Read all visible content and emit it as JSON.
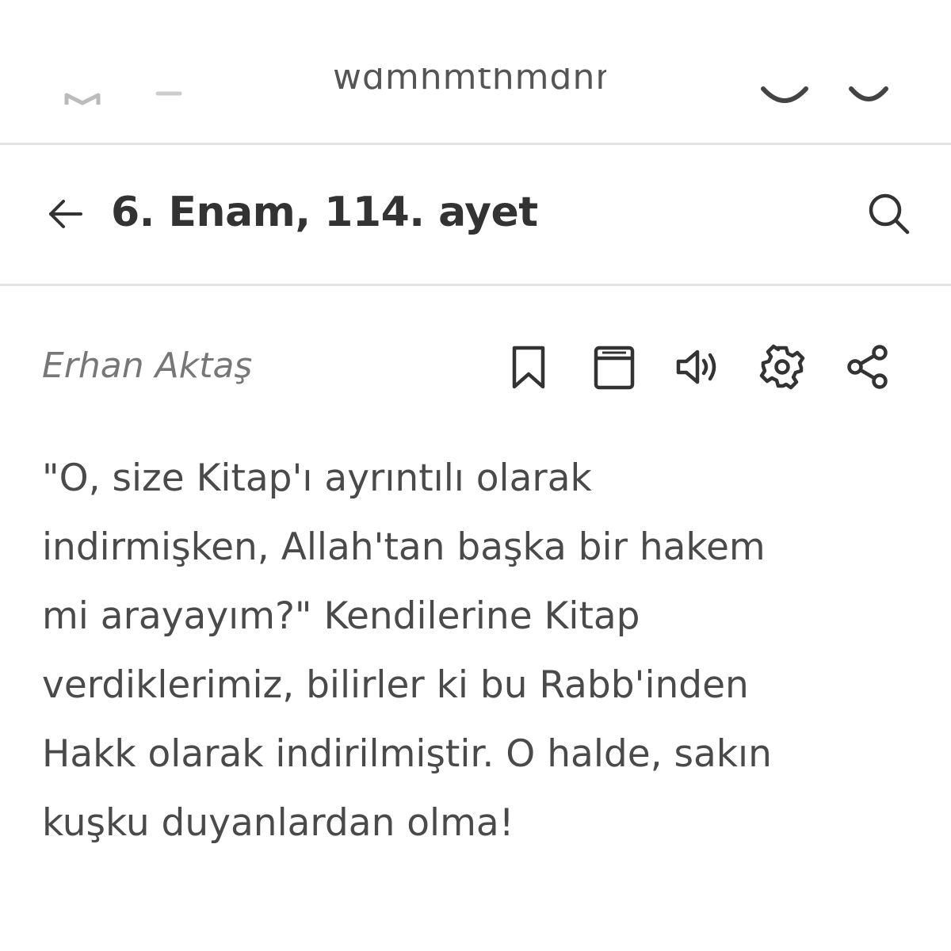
{
  "browser": {
    "url_fragment": "wdmhmthmdnmtmh"
  },
  "header": {
    "title": "6. Enam, 114. ayet"
  },
  "translation": {
    "author": "Erhan Aktaş",
    "lines": [
      "\"O, size Kitap'ı ayrıntılı olarak",
      "indirmişken, Allah'tan başka bir hakem",
      "mi arayayım?\" Kendilerine Kitap",
      "verdiklerimiz, bilirler ki bu Rabb'inden",
      "Hakk olarak indirilmiştir. O halde, sakın",
      "kuşku duyanlardan olma!"
    ]
  },
  "toolbar": {
    "icons": [
      "bookmark-icon",
      "book-icon",
      "speaker-icon",
      "gear-icon",
      "share-icon"
    ]
  },
  "colors": {
    "divider": "#e3e3e3",
    "icon": "#333333",
    "author": "#777777",
    "text": "#4a4a4a"
  }
}
